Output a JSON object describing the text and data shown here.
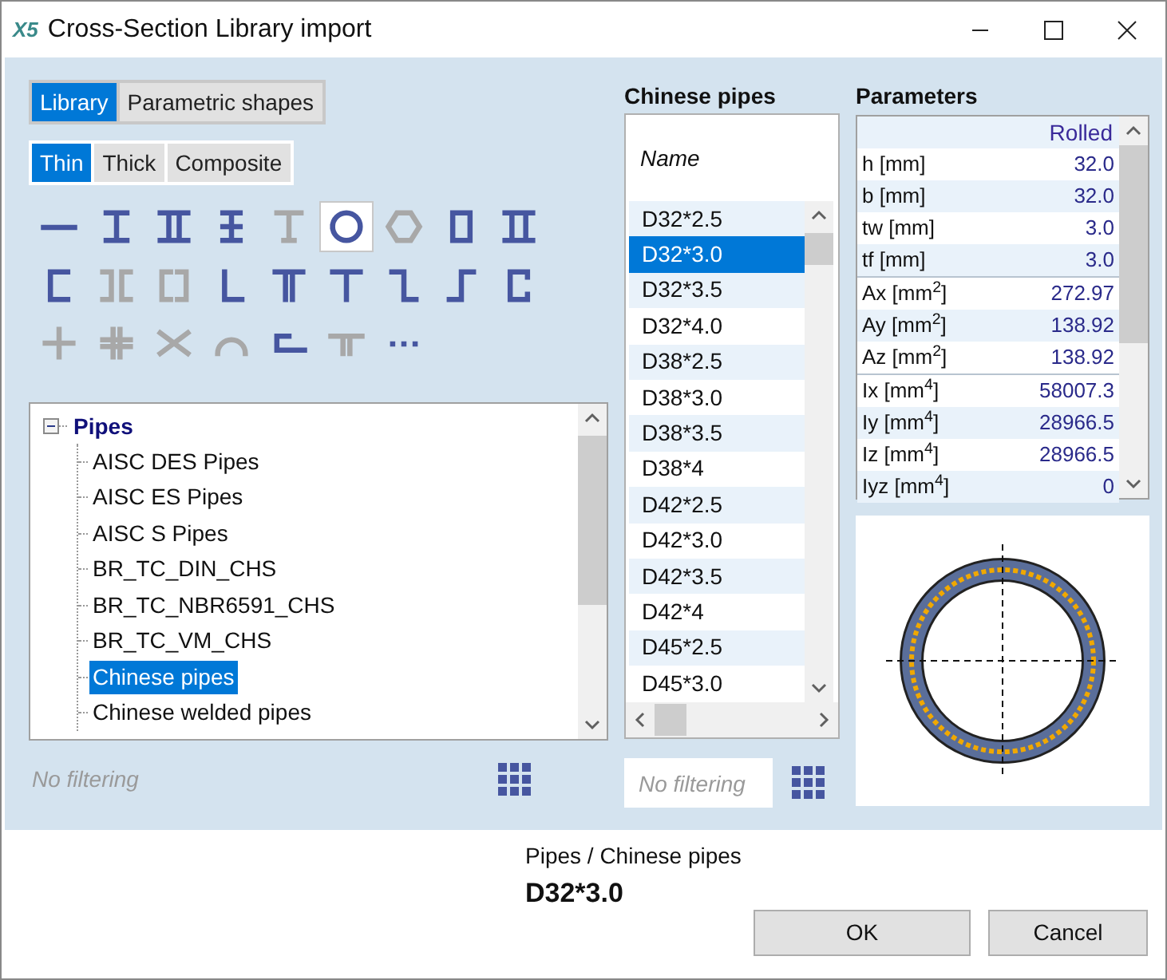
{
  "window": {
    "logo": "X5",
    "title": "Cross-Section Library import"
  },
  "source_tabs": [
    {
      "label": "Library",
      "selected": true
    },
    {
      "label": "Parametric shapes",
      "selected": false
    }
  ],
  "type_tabs": [
    {
      "label": "Thin",
      "selected": true
    },
    {
      "label": "Thick",
      "selected": false
    },
    {
      "label": "Composite",
      "selected": false
    }
  ],
  "shapes": [
    {
      "kind": "flat",
      "enabled": true,
      "selected": false
    },
    {
      "kind": "i",
      "enabled": true,
      "selected": false
    },
    {
      "kind": "double-i",
      "enabled": true,
      "selected": false
    },
    {
      "kind": "i-stiffened",
      "enabled": true,
      "selected": false
    },
    {
      "kind": "tee-i",
      "enabled": false,
      "selected": false
    },
    {
      "kind": "circle",
      "enabled": true,
      "selected": true
    },
    {
      "kind": "hexagon",
      "enabled": false,
      "selected": false
    },
    {
      "kind": "box",
      "enabled": true,
      "selected": false
    },
    {
      "kind": "double-box",
      "enabled": true,
      "selected": false
    },
    {
      "kind": "channel",
      "enabled": true,
      "selected": false
    },
    {
      "kind": "double-channel",
      "enabled": false,
      "selected": false
    },
    {
      "kind": "double-channel-box",
      "enabled": false,
      "selected": false
    },
    {
      "kind": "angle",
      "enabled": true,
      "selected": false
    },
    {
      "kind": "double-tee",
      "enabled": true,
      "selected": false
    },
    {
      "kind": "tee",
      "enabled": true,
      "selected": false
    },
    {
      "kind": "zee",
      "enabled": true,
      "selected": false
    },
    {
      "kind": "zee-rev",
      "enabled": true,
      "selected": false
    },
    {
      "kind": "lipped-channel",
      "enabled": true,
      "selected": false
    },
    {
      "kind": "cross",
      "enabled": false,
      "selected": false
    },
    {
      "kind": "cross-double",
      "enabled": false,
      "selected": false
    },
    {
      "kind": "x",
      "enabled": false,
      "selected": false
    },
    {
      "kind": "arc",
      "enabled": false,
      "selected": false
    },
    {
      "kind": "angle-plate",
      "enabled": true,
      "selected": false
    },
    {
      "kind": "tee-plate",
      "enabled": false,
      "selected": false
    },
    {
      "kind": "more",
      "enabled": true,
      "selected": false
    }
  ],
  "tree": {
    "label": "Pipes",
    "expanded": true,
    "children": [
      {
        "label": "AISC DES Pipes",
        "selected": false
      },
      {
        "label": "AISC ES Pipes",
        "selected": false
      },
      {
        "label": "AISC S Pipes",
        "selected": false
      },
      {
        "label": "BR_TC_DIN_CHS",
        "selected": false
      },
      {
        "label": "BR_TC_NBR6591_CHS",
        "selected": false
      },
      {
        "label": "BR_TC_VM_CHS",
        "selected": false
      },
      {
        "label": "Chinese pipes",
        "selected": true
      },
      {
        "label": "Chinese welded pipes",
        "selected": false
      }
    ]
  },
  "tree_filter": {
    "placeholder": "No filtering"
  },
  "list": {
    "title": "Chinese pipes",
    "column": "Name",
    "rows": [
      {
        "label": "D32*2.5",
        "selected": false
      },
      {
        "label": "D32*3.0",
        "selected": true
      },
      {
        "label": "D32*3.5",
        "selected": false
      },
      {
        "label": "D32*4.0",
        "selected": false
      },
      {
        "label": "D38*2.5",
        "selected": false
      },
      {
        "label": "D38*3.0",
        "selected": false
      },
      {
        "label": "D38*3.5",
        "selected": false
      },
      {
        "label": "D38*4",
        "selected": false
      },
      {
        "label": "D42*2.5",
        "selected": false
      },
      {
        "label": "D42*3.0",
        "selected": false
      },
      {
        "label": "D42*3.5",
        "selected": false
      },
      {
        "label": "D42*4",
        "selected": false
      },
      {
        "label": "D45*2.5",
        "selected": false
      },
      {
        "label": "D45*3.0",
        "selected": false
      }
    ],
    "filter": {
      "placeholder": "No filtering"
    }
  },
  "parameters": {
    "title": "Parameters",
    "column": "Rolled",
    "groups": [
      [
        {
          "label": "h [mm]",
          "value": "32.0"
        },
        {
          "label": "b [mm]",
          "value": "32.0"
        },
        {
          "label": "tw [mm]",
          "value": "3.0"
        },
        {
          "label": "tf [mm]",
          "value": "3.0"
        }
      ],
      [
        {
          "label": "Ax [mm$^{2}$]",
          "value": "272.97"
        },
        {
          "label": "Ay [mm$^{2}$]",
          "value": "138.92"
        },
        {
          "label": "Az [mm$^{2}$]",
          "value": "138.92"
        }
      ],
      [
        {
          "label": "Ix [mm$^{4}$]",
          "value": "58007.3"
        },
        {
          "label": "Iy [mm$^{4}$]",
          "value": "28966.5"
        },
        {
          "label": "Iz [mm$^{4}$]",
          "value": "28966.5"
        },
        {
          "label": "Iyz [mm$^{4}$]",
          "value": "0"
        }
      ]
    ]
  },
  "footer": {
    "path": "Pipes / Chinese pipes",
    "selection": "D32*3.0",
    "buttons": [
      "OK",
      "Cancel"
    ]
  }
}
